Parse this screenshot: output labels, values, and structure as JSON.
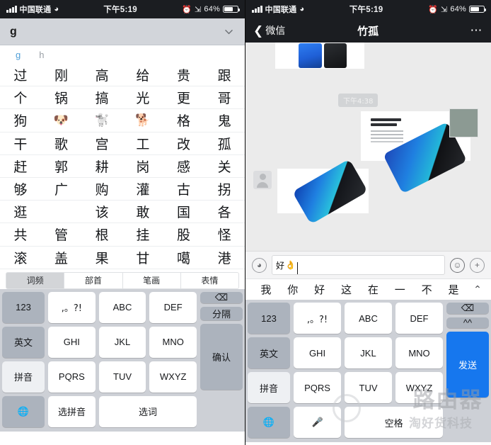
{
  "status_bar": {
    "carrier": "中国联通",
    "wifi_icon": "wifi-icon",
    "time": "下午5:19",
    "alarm_icon": "alarm-clock-icon",
    "bluetooth_icon": "bluetooth-icon",
    "battery_percent": "64%"
  },
  "left_pane": {
    "compose": {
      "text": "g",
      "collapse_icon": "chevron-down-icon"
    },
    "pinyin_hints": [
      {
        "label": "g",
        "active": true
      },
      {
        "label": "h",
        "active": false
      }
    ],
    "candidate_rows": [
      [
        "过",
        "刚",
        "高",
        "给",
        "贵",
        "跟"
      ],
      [
        "个",
        "锅",
        "搞",
        "光",
        "更",
        "哥"
      ],
      [
        "狗",
        "🐶",
        "🐩",
        "🐕",
        "格",
        "鬼"
      ],
      [
        "干",
        "歌",
        "宫",
        "工",
        "改",
        "孤"
      ],
      [
        "赶",
        "郭",
        "耕",
        "岗",
        "感",
        "关"
      ],
      [
        "够",
        "广",
        "购",
        "灌",
        "古",
        "拐"
      ],
      [
        "逛",
        "",
        "该",
        "敢",
        "国",
        "各"
      ],
      [
        "共",
        "管",
        "根",
        "挂",
        "股",
        "怪"
      ],
      [
        "滚",
        "盖",
        "果",
        "甘",
        "噶",
        "港"
      ]
    ],
    "tabs": [
      {
        "label": "词频",
        "active": true
      },
      {
        "label": "部首",
        "active": false
      },
      {
        "label": "笔画",
        "active": false
      },
      {
        "label": "表情",
        "active": false
      }
    ],
    "keyboard": {
      "rows": [
        [
          {
            "label": "123",
            "style": "gray",
            "name": "key-123"
          },
          {
            "label": ",。?!",
            "style": "white",
            "name": "key-punctuation"
          },
          {
            "label": "ABC",
            "style": "white",
            "name": "key-abc"
          },
          {
            "label": "DEF",
            "style": "white",
            "name": "key-def"
          },
          {
            "label": "⌫",
            "style": "gray",
            "name": "key-delete"
          }
        ],
        [
          {
            "label": "英文",
            "style": "gray",
            "name": "key-english"
          },
          {
            "label": "GHI",
            "style": "white",
            "name": "key-ghi"
          },
          {
            "label": "JKL",
            "style": "white",
            "name": "key-jkl"
          },
          {
            "label": "MNO",
            "style": "white",
            "name": "key-mno"
          },
          {
            "label": "分隔",
            "style": "gray",
            "name": "key-separator"
          }
        ],
        [
          {
            "label": "拼音",
            "style": "light",
            "name": "key-pinyin"
          },
          {
            "label": "PQRS",
            "style": "white",
            "name": "key-pqrs"
          },
          {
            "label": "TUV",
            "style": "white",
            "name": "key-tuv"
          },
          {
            "label": "WXYZ",
            "style": "white",
            "name": "key-wxyz"
          },
          {
            "label": "确认",
            "style": "gray",
            "name": "key-confirm"
          }
        ],
        [
          {
            "label": "🌐",
            "style": "gray",
            "name": "key-globe"
          },
          {
            "label": "选拼音",
            "style": "white",
            "name": "key-choose-pinyin"
          },
          {
            "label": "选词",
            "style": "white",
            "name": "key-choose-word"
          }
        ]
      ]
    }
  },
  "right_pane": {
    "nav": {
      "back_label": "微信",
      "back_icon": "chevron-left-icon",
      "title": "竹孤",
      "more_icon": "more-dots-icon"
    },
    "chat": {
      "timestamp": "下午4:38",
      "messages": [
        {
          "name": "message-image-1",
          "kind": "image"
        },
        {
          "name": "message-image-2",
          "kind": "image"
        },
        {
          "name": "message-image-3",
          "kind": "image"
        }
      ]
    },
    "input_bar": {
      "voice_icon": "voice-wave-icon",
      "text_value": "好",
      "text_emoji": "👌",
      "placeholder": "",
      "emoji_icon": "smiley-icon",
      "plus_icon": "plus-icon"
    },
    "suggestions": {
      "items": [
        "我",
        "你",
        "好",
        "这",
        "在",
        "一",
        "不",
        "是"
      ],
      "expand_icon": "chevron-up-icon"
    },
    "keyboard": {
      "rows": [
        [
          {
            "label": "123",
            "style": "gray",
            "name": "key-123"
          },
          {
            "label": ",。?!",
            "style": "white",
            "name": "key-punctuation"
          },
          {
            "label": "ABC",
            "style": "white",
            "name": "key-abc"
          },
          {
            "label": "DEF",
            "style": "white",
            "name": "key-def"
          },
          {
            "label": "⌫",
            "style": "gray",
            "name": "key-delete"
          }
        ],
        [
          {
            "label": "英文",
            "style": "gray",
            "name": "key-english"
          },
          {
            "label": "GHI",
            "style": "white",
            "name": "key-ghi"
          },
          {
            "label": "JKL",
            "style": "white",
            "name": "key-jkl"
          },
          {
            "label": "MNO",
            "style": "white",
            "name": "key-mno"
          },
          {
            "label": "^^",
            "style": "gray",
            "name": "key-kaomoji"
          }
        ],
        [
          {
            "label": "拼音",
            "style": "light",
            "name": "key-pinyin"
          },
          {
            "label": "PQRS",
            "style": "white",
            "name": "key-pqrs"
          },
          {
            "label": "TUV",
            "style": "white",
            "name": "key-tuv"
          },
          {
            "label": "WXYZ",
            "style": "white",
            "name": "key-wxyz"
          },
          {
            "label": "发送",
            "style": "blue",
            "name": "key-send"
          }
        ],
        [
          {
            "label": "🌐",
            "style": "gray",
            "name": "key-globe"
          },
          {
            "label": "🎤",
            "style": "white",
            "name": "key-microphone"
          },
          {
            "label": "空格",
            "style": "white",
            "name": "key-space"
          }
        ]
      ]
    },
    "watermark": {
      "main": "路由器",
      "sub": "淘好货科技",
      "logo_icon": "circle-logo-icon"
    }
  },
  "colors": {
    "accent_blue": "#1677ee",
    "status_bar_bg": "#1b1d21",
    "keyboard_bg": "#cdd0d6",
    "chat_bg": "#ebebeb"
  }
}
